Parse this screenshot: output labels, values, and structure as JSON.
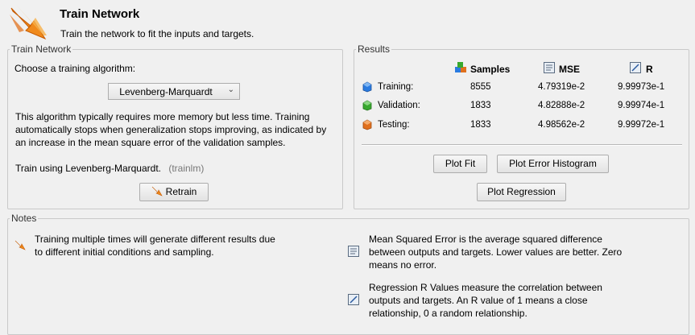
{
  "header": {
    "title": "Train Network",
    "subtitle": "Train the network to fit the inputs and targets."
  },
  "train_panel": {
    "legend": "Train Network",
    "choose_label": "Choose a training algorithm:",
    "algorithm_selected": "Levenberg-Marquardt",
    "description_lines": [
      "This algorithm typically requires more memory but less time. Training",
      "automatically stops when generalization stops improving, as indicated by",
      "an increase in the mean square error of the validation samples."
    ],
    "train_using": "Train using Levenberg-Marquardt.",
    "train_fn": "(trainlm)",
    "retrain_label": "Retrain"
  },
  "results_panel": {
    "legend": "Results",
    "columns": {
      "samples": "Samples",
      "mse": "MSE",
      "r": "R"
    },
    "rows": [
      {
        "label": "Training:",
        "samples": "8555",
        "mse": "4.79319e-2",
        "r": "9.99973e-1",
        "color": "#2a7be0"
      },
      {
        "label": "Validation:",
        "samples": "1833",
        "mse": "4.82888e-2",
        "r": "9.99974e-1",
        "color": "#38a82e"
      },
      {
        "label": "Testing:",
        "samples": "1833",
        "mse": "4.98562e-2",
        "r": "9.99972e-1",
        "color": "#e0701d"
      }
    ],
    "buttons": {
      "plot_fit": "Plot Fit",
      "plot_error_histogram": "Plot Error Histogram",
      "plot_regression": "Plot Regression"
    }
  },
  "notes_panel": {
    "legend": "Notes",
    "note1_lines": [
      "Training multiple times will generate different results due",
      "to different initial conditions and sampling."
    ],
    "note2_lines": [
      "Mean Squared Error is the average squared difference",
      "between outputs and targets. Lower values are better. Zero",
      "means no error."
    ],
    "note3_lines": [
      "Regression R Values measure the correlation between",
      "outputs and targets. An R value of 1 means a close",
      "relationship, 0 a random relationship."
    ]
  },
  "icons": {
    "logo": "train-network-arrow-icon",
    "samples": "cubes-icon",
    "mse": "mse-chart-icon",
    "r": "regression-icon",
    "retrain": "train-arrow-icon"
  }
}
